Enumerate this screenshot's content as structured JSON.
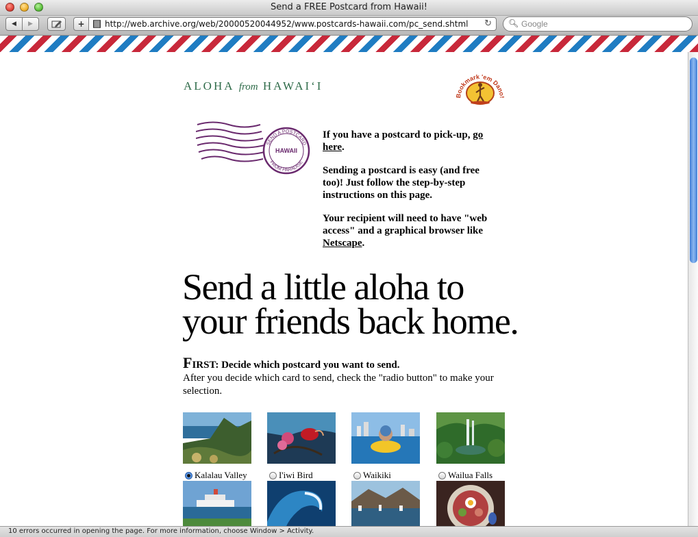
{
  "window": {
    "title": "Send a FREE Postcard from Hawaii!"
  },
  "toolbar": {
    "back_icon": "◀",
    "forward_icon": "▶",
    "add_label": "+",
    "url": "http://web.archive.org/web/20000520044952/www.postcards-hawaii.com/pc_send.shtml",
    "search_placeholder": "Google"
  },
  "page": {
    "logo": {
      "part1": "ALOHA",
      "part2": "from",
      "part3": "HAWAI‘I"
    },
    "badge_text": "Bookmark 'em Dano!",
    "stamp": {
      "top": "SEND A POSTCARD",
      "middle": "HAWAII",
      "bottom": "FROM PARADISE"
    },
    "intro": {
      "pickup_prefix": "If you have a postcard to pick-up, ",
      "pickup_link": "go here",
      "pickup_suffix": ".",
      "easy_text": "Sending a postcard is easy (and free too)! Just follow the step-by-step instructions on this page.",
      "access_prefix": "Your recipient will need to have \"web access\" and a graphical browser like ",
      "access_link": "Netscape",
      "access_suffix": "."
    },
    "headline_line1": "Send a little aloha to",
    "headline_line2": "your friends back home.",
    "step_first_big": "F",
    "step_first_rest": "IRST: Decide which postcard you want to send.",
    "step_desc": "After you decide which card to send, check the \"radio button\" to make your selection.",
    "cards": [
      {
        "label": "Kalalau Valley",
        "selected": true
      },
      {
        "label": "I'iwi Bird",
        "selected": false
      },
      {
        "label": "Waikiki",
        "selected": false
      },
      {
        "label": "Wailua Falls",
        "selected": false
      }
    ]
  },
  "statusbar": {
    "text": "10 errors occurred in opening the page. For more information, choose Window > Activity."
  },
  "colors": {
    "logo": "#2e6b49",
    "airmail_red": "#c8283a",
    "airmail_blue": "#1f7cc2"
  }
}
